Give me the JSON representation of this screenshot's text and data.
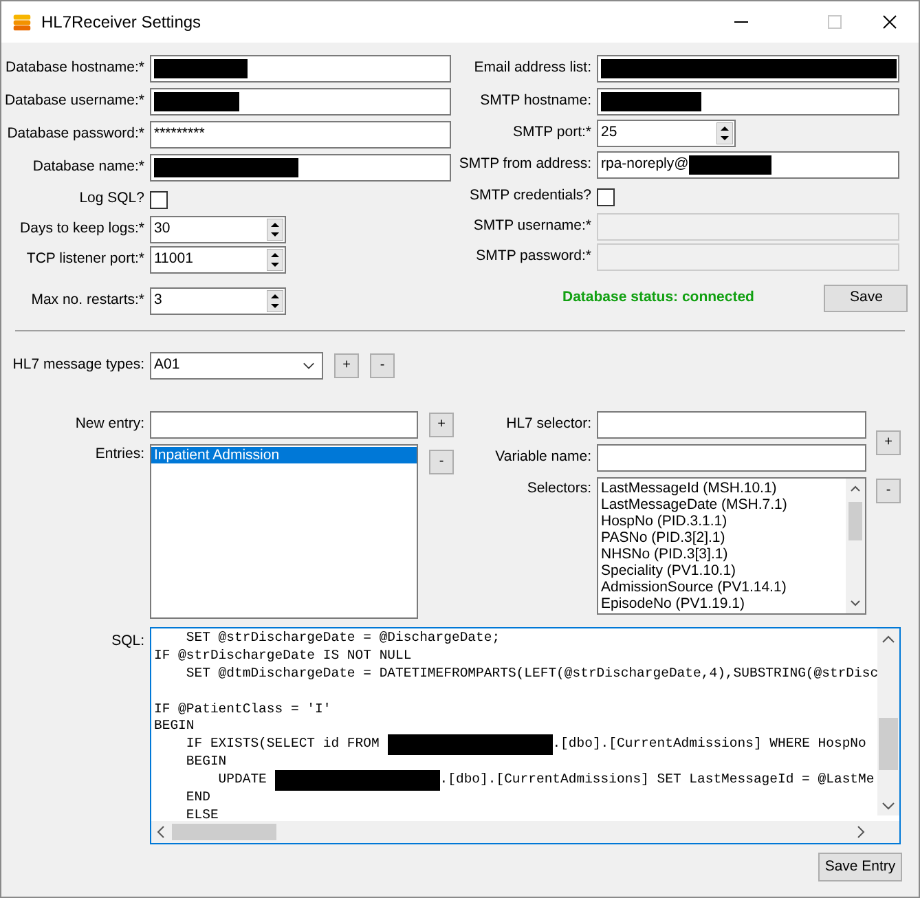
{
  "window": {
    "title": "HL7Receiver Settings"
  },
  "left_fields": [
    {
      "kind": "text",
      "label": "Database hostname:*",
      "redacted": true,
      "disabled": false
    },
    {
      "kind": "text",
      "label": "Database username:*",
      "redacted": true,
      "disabled": false
    },
    {
      "kind": "text",
      "label": "Database password:*",
      "value": "*********",
      "redacted": false,
      "disabled": false
    },
    {
      "kind": "text",
      "label": "Database name:*",
      "redacted": true,
      "disabled": false
    },
    {
      "kind": "checkbox",
      "label": "Log SQL?",
      "checked": false
    },
    {
      "kind": "spin",
      "label": "Days to keep logs:*",
      "value": "30"
    },
    {
      "kind": "spin",
      "label": "TCP listener port:*",
      "value": "11001"
    },
    {
      "kind": "spin",
      "label": "Max no. restarts:*",
      "value": "3"
    }
  ],
  "right_fields": [
    {
      "kind": "text",
      "label": "Email address list:",
      "redacted": true,
      "disabled": false
    },
    {
      "kind": "text",
      "label": "SMTP hostname:",
      "redacted": true,
      "disabled": false
    },
    {
      "kind": "spin",
      "label": "SMTP port:*",
      "value": "25"
    },
    {
      "kind": "text",
      "label": "SMTP from address:",
      "value": "rpa-noreply@",
      "redacted": true,
      "disabled": false
    },
    {
      "kind": "checkbox",
      "label": "SMTP credentials?",
      "checked": false
    },
    {
      "kind": "text",
      "label": "SMTP username:*",
      "redacted": false,
      "disabled": true
    },
    {
      "kind": "text",
      "label": "SMTP password:*",
      "redacted": false,
      "disabled": true
    }
  ],
  "database_status": "Database status: connected",
  "save_button": "Save",
  "message_types": {
    "label": "HL7 message types:",
    "value": "A01",
    "add": "+",
    "remove": "-"
  },
  "entries": {
    "new_entry_label": "New entry:",
    "add": "+",
    "label": "Entries:",
    "remove": "-",
    "items": [
      {
        "text": "Inpatient Admission",
        "selected": true
      }
    ]
  },
  "selectors": {
    "selector_label": "HL7 selector:",
    "variable_label": "Variable name:",
    "add": "+",
    "label": "Selectors:",
    "remove": "-",
    "items": [
      {
        "text": "LastMessageId (MSH.10.1)",
        "selected": false
      },
      {
        "text": "LastMessageDate (MSH.7.1)",
        "selected": false
      },
      {
        "text": "HospNo (PID.3.1.1)",
        "selected": false
      },
      {
        "text": "PASNo (PID.3[2].1)",
        "selected": false
      },
      {
        "text": "NHSNo (PID.3[3].1)",
        "selected": false
      },
      {
        "text": "Speciality (PV1.10.1)",
        "selected": false
      },
      {
        "text": "AdmissionSource (PV1.14.1)",
        "selected": false
      },
      {
        "text": "EpisodeNo (PV1.19.1)",
        "selected": false
      }
    ]
  },
  "sql": {
    "label": "SQL:",
    "lines": [
      [
        {
          "kind": "text",
          "text": "    SET @strDischargeDate = @DischargeDate;"
        }
      ],
      [
        {
          "kind": "text",
          "text": "IF @strDischargeDate IS NOT NULL"
        }
      ],
      [
        {
          "kind": "text",
          "text": "    SET @dtmDischargeDate = DATETIMEFROMPARTS(LEFT(@strDischargeDate,4),SUBSTRING(@strDisc"
        }
      ],
      {
        "kind": "blank"
      },
      [
        {
          "kind": "text",
          "text": "IF @PatientClass = 'I'"
        }
      ],
      [
        {
          "kind": "text",
          "text": "BEGIN"
        }
      ],
      [
        {
          "kind": "text",
          "text": "    IF EXISTS(SELECT id FROM "
        },
        {
          "kind": "redacted"
        },
        {
          "kind": "text",
          "text": ".[dbo].[CurrentAdmissions] WHERE HospNo"
        }
      ],
      [
        {
          "kind": "text",
          "text": "    BEGIN"
        }
      ],
      [
        {
          "kind": "text",
          "text": "        UPDATE "
        },
        {
          "kind": "redacted"
        },
        {
          "kind": "text",
          "text": ".[dbo].[CurrentAdmissions] SET LastMessageId = @LastMe"
        }
      ],
      [
        {
          "kind": "text",
          "text": "    END"
        }
      ],
      [
        {
          "kind": "text",
          "text": "    ELSE"
        }
      ]
    ]
  },
  "save_entry_button": "Save Entry"
}
